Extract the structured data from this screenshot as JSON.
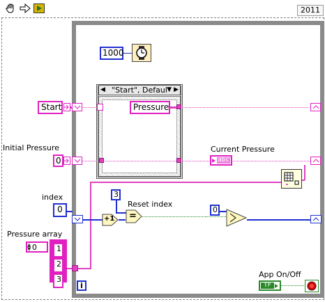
{
  "toolbar": {
    "version": "2011",
    "tools": [
      "hand-tool",
      "run-arrow-tool",
      "highlight-tool"
    ]
  },
  "diagram": {
    "wait_constant": "1000",
    "case_selector": "\"Start\", Defaul",
    "start_control": "Start",
    "pressure_constant": "Pressure",
    "initial_pressure_label": "Initial Pressure",
    "initial_pressure_value": "0",
    "current_pressure_label": "Current Pressure",
    "current_pressure_indicator": "abc",
    "index_label": "index",
    "index_value": "0",
    "reset_constant": "3",
    "reset_label": "Reset index",
    "zero_constant": "0",
    "pressure_array_label": "Pressure array",
    "array_index_value": "0",
    "array_items": [
      "1",
      "2",
      "3"
    ],
    "app_onoff_label": "App On/Off",
    "bool_indicator_text": "TF",
    "iteration_terminal": "i",
    "increment_symbol": "+1",
    "equal_symbol": "="
  },
  "colors": {
    "string_pink": "#e020c0",
    "numeric_blue": "#1f2fd0",
    "boolean_green": "#2a8a2a",
    "loop_gray": "#8a8a8a"
  }
}
